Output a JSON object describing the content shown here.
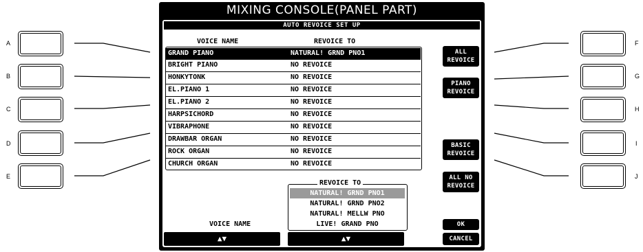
{
  "title": "MIXING CONSOLE(PANEL PART)",
  "subtitle": "AUTO REVOICE SET UP",
  "columns": {
    "voice_name": "VOICE NAME",
    "revoice_to": "REVOICE TO"
  },
  "rows": [
    {
      "voice": "GRAND PIANO",
      "revoice": "NATURAL! GRND PNO1"
    },
    {
      "voice": "BRIGHT PIANO",
      "revoice": "NO REVOICE"
    },
    {
      "voice": "HONKYTONK",
      "revoice": "NO REVOICE"
    },
    {
      "voice": "EL.PIANO 1",
      "revoice": "NO REVOICE"
    },
    {
      "voice": "EL.PIANO 2",
      "revoice": "NO REVOICE"
    },
    {
      "voice": "HARPSICHORD",
      "revoice": "NO REVOICE"
    },
    {
      "voice": "VIBRAPHONE",
      "revoice": "NO REVOICE"
    },
    {
      "voice": "DRAWBAR ORGAN",
      "revoice": "NO REVOICE"
    },
    {
      "voice": "ROCK ORGAN",
      "revoice": "NO REVOICE"
    },
    {
      "voice": "CHURCH ORGAN",
      "revoice": "NO REVOICE"
    }
  ],
  "selected_row": 0,
  "buttons": {
    "all_revoice": [
      "ALL",
      "REVOICE"
    ],
    "piano_revoice": [
      "PIANO",
      "REVOICE"
    ],
    "basic_revoice": [
      "BASIC",
      "REVOICE"
    ],
    "all_no_revoice": [
      "ALL NO",
      "REVOICE"
    ],
    "ok": "OK",
    "cancel": "CANCEL"
  },
  "revoice_box": {
    "label": "REVOICE TO",
    "options": [
      "NATURAL! GRND PNO1",
      "NATURAL! GRND PNO2",
      "NATURAL! MELLW PNO",
      "LIVE! GRAND PNO"
    ],
    "selected": 0
  },
  "bottom": {
    "voice_name_label": "VOICE NAME",
    "arrows": "▲▼"
  },
  "panel_buttons": {
    "left": [
      "A",
      "B",
      "C",
      "D",
      "E"
    ],
    "right": [
      "F",
      "G",
      "H",
      "I",
      "J"
    ]
  }
}
